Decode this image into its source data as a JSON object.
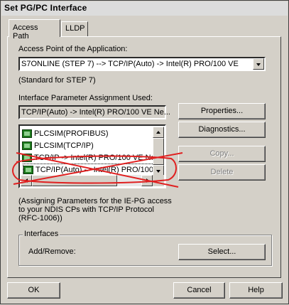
{
  "window": {
    "title": "Set PG/PC Interface"
  },
  "tabs": [
    {
      "label": "Access Path",
      "active": true
    },
    {
      "label": "LLDP",
      "active": false
    }
  ],
  "access_point": {
    "label": "Access Point of the Application:",
    "value": "S7ONLINE      (STEP 7)      --> TCP/IP(Auto) -> Intel(R) PRO/100 VE",
    "note": "(Standard for STEP 7)"
  },
  "interface_param": {
    "label": "Interface Parameter Assignment Used:",
    "value": "TCP/IP(Auto) -> Intel(R) PRO/100 VE Ne...",
    "items": [
      "PLCSIM(PROFIBUS)",
      "PLCSIM(TCP/IP)",
      "TCP/IP -> Intel(R) PRO/100 VE Ne",
      "TCP/IP(Auto) -> Intel(R) PRO/100 '"
    ],
    "selected_index": 3
  },
  "buttons": {
    "properties": "Properties...",
    "diagnostics": "Diagnostics...",
    "copy": "Copy...",
    "delete": "Delete",
    "select": "Select...",
    "ok": "OK",
    "cancel": "Cancel",
    "help": "Help"
  },
  "description": "(Assigning Parameters for the IE-PG access\nto your NDIS CPs with TCP/IP Protocol\n(RFC-1006))",
  "interfaces": {
    "group_label": "Interfaces",
    "add_remove_label": "Add/Remove:"
  },
  "colors": {
    "dialog_bg": "#d4d0c8",
    "annotation_red": "#e02020"
  }
}
